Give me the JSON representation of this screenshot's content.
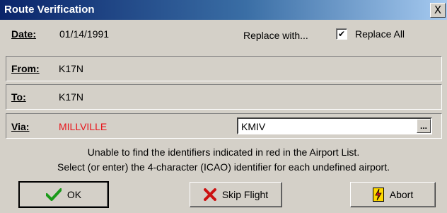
{
  "window": {
    "title": "Route Verification",
    "close_label": "X"
  },
  "date": {
    "label": "Date:",
    "value": "01/14/1991"
  },
  "replace_with_label": "Replace with...",
  "replace_all": {
    "label": "Replace All",
    "checked": true,
    "mark": "✔"
  },
  "from": {
    "label": "From:",
    "value": "K17N"
  },
  "to": {
    "label": "To:",
    "value": "K17N"
  },
  "via": {
    "label": "Via:",
    "value": "MILLVILLE",
    "value_color": "#e8141b",
    "replacement": "KMIV",
    "browse_label": "..."
  },
  "message": {
    "line1": "Unable to find the identifiers indicated in red in the Airport List.",
    "line2": "Select (or enter) the 4-character (ICAO) identifier for each undefined airport."
  },
  "buttons": {
    "ok": {
      "label": "OK",
      "icon": "checkmark-icon"
    },
    "skip": {
      "label": "Skip Flight",
      "icon": "x-icon"
    },
    "abort": {
      "label": "Abort",
      "icon": "lightning-icon"
    }
  }
}
